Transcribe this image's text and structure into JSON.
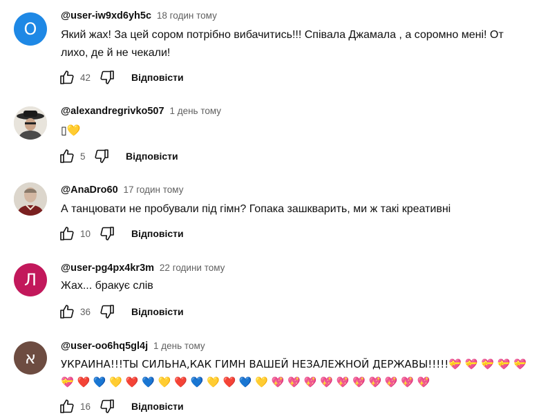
{
  "reply_label": "Відповісти",
  "colors": {
    "avatar_1": "#1e88e5",
    "avatar_4": "#c2185b",
    "avatar_5": "#6d4c41"
  },
  "comments": [
    {
      "author": "@user-iw9xd6yh5c",
      "time": "18 годин тому",
      "avatar_letter": "O",
      "text": "Який жах! За цей сором потрібно вибачитись!!! Співала Джамала , а соромно мені! От лихо, де й не чекали!",
      "likes": "42"
    },
    {
      "author": "@alexandregrivko507",
      "time": "1 день тому",
      "text": "▯💛",
      "likes": "5"
    },
    {
      "author": "@AnaDro60",
      "time": "17 годин тому",
      "text": "А танцювати не пробували під гімн? Гопака зашкварить, ми ж такі креативні",
      "likes": "10"
    },
    {
      "author": "@user-pg4px4kr3m",
      "time": "22 години тому",
      "avatar_letter": "Л",
      "text": "Жах... бракує слів",
      "likes": "36"
    },
    {
      "author": "@user-oo6hq5gl4j",
      "time": "1 день тому",
      "avatar_letter": "א",
      "text": "УКРАИНА!!!ТЫ СИЛЬНА,КАК ГИМН ВАШЕЙ НЕЗАЛЕЖНОЙ ДЕРЖАВЫ!!!!!💝 💝 💝 💝 💝 💝 ❤️ 💙 💛 ❤️ 💙 💛 ❤️ 💙 💛 ❤️ 💙 💛 💖 💖 💖 💖 💖 💖 💖 💖 💖 💖",
      "likes": "16"
    }
  ]
}
